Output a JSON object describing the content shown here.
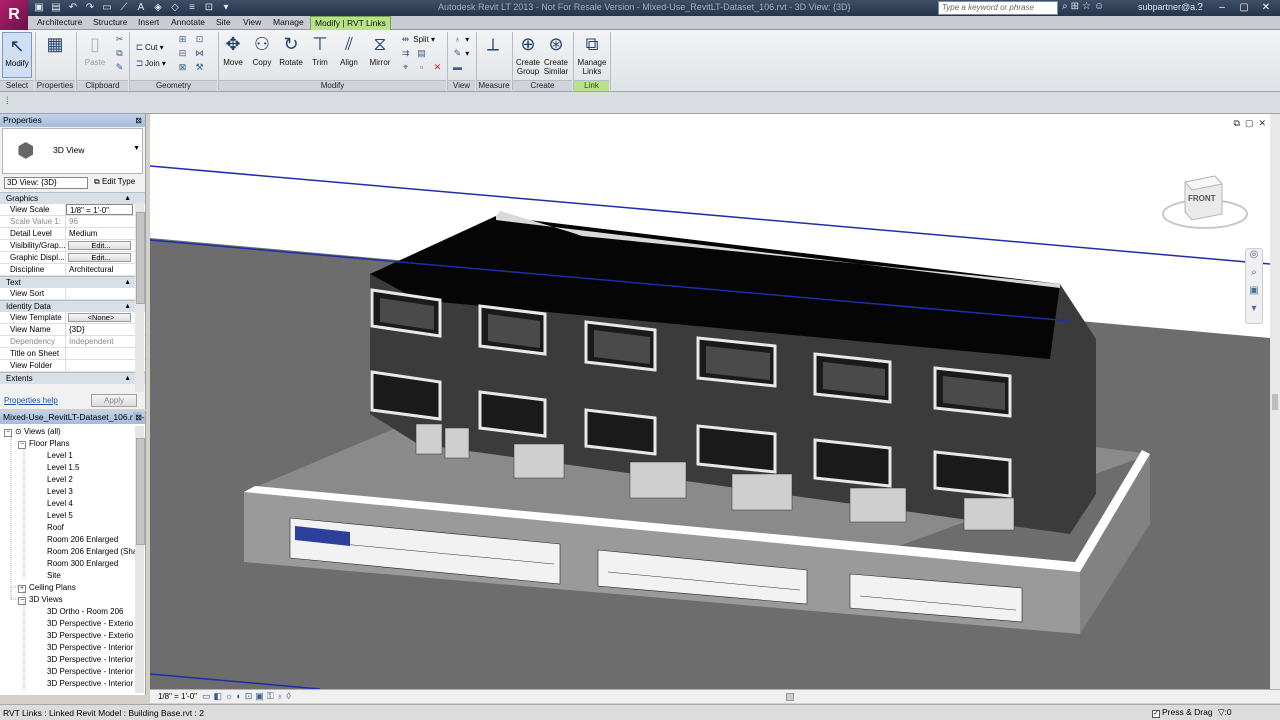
{
  "app": {
    "logo": "R",
    "window_title": "Autodesk Revit LT 2013 - Not For Resale Version -    Mixed-Use_RevitLT-Dataset_106.rvt - 3D View: {3D}"
  },
  "titlebar": {
    "search_placeholder": "Type a keyword or phrase",
    "user": "subpartner@a...",
    "qat_icons": [
      "open-icon",
      "save-icon",
      "undo-icon",
      "redo-icon",
      "print-icon",
      "measure-icon",
      "text-icon",
      "3d-view-icon",
      "section-icon",
      "thin-lines-icon",
      "close-views-icon",
      "switch-windows-icon"
    ]
  },
  "ribbon_tabs": [
    "Architecture",
    "Structure",
    "Insert",
    "Annotate",
    "Site",
    "View",
    "Manage",
    "Modify | RVT Links"
  ],
  "ribbon": {
    "select": {
      "modify": "Modify",
      "label": "Select"
    },
    "properties": {
      "label": "Properties"
    },
    "clipboard": {
      "paste": "Paste",
      "label": "Clipboard"
    },
    "geometry": {
      "cut": "Cut",
      "join": "Join",
      "label": "Geometry"
    },
    "modify": {
      "move": "Move",
      "copy": "Copy",
      "rotate": "Rotate",
      "trim": "Trim",
      "align": "Align",
      "mirror": "Mirror",
      "split": "Split",
      "label": "Modify"
    },
    "view": {
      "label": "View"
    },
    "measure": {
      "label": "Measure"
    },
    "create": {
      "create_group": "Create\nGroup",
      "create_group_1": "Create",
      "create_group_2": "Group",
      "create_similar_1": "Create",
      "create_similar_2": "Similar",
      "label": "Create"
    },
    "link": {
      "manage_1": "Manage",
      "manage_2": "Links",
      "label": "Link"
    }
  },
  "properties": {
    "title": "Properties",
    "type_name": "3D View",
    "view_select": "3D View: {3D}",
    "edit_type": "Edit Type",
    "groups": {
      "graphics": "Graphics",
      "text": "Text",
      "identity": "Identity Data",
      "extents": "Extents"
    },
    "rows": {
      "view_scale": {
        "name": "View Scale",
        "value": "1/8\" = 1'-0\""
      },
      "scale_value": {
        "name": "Scale Value    1:",
        "value": "96"
      },
      "detail_level": {
        "name": "Detail Level",
        "value": "Medium"
      },
      "visibility": {
        "name": "Visibility/Grap...",
        "value": "Edit..."
      },
      "graphic_display": {
        "name": "Graphic Displ...",
        "value": "Edit..."
      },
      "discipline": {
        "name": "Discipline",
        "value": "Architectural"
      },
      "view_sort": {
        "name": "View Sort",
        "value": ""
      },
      "view_template": {
        "name": "View Template",
        "value": "<None>"
      },
      "view_name": {
        "name": "View Name",
        "value": "{3D}"
      },
      "dependency": {
        "name": "Dependency",
        "value": "Independent"
      },
      "title_on_sheet": {
        "name": "Title on Sheet",
        "value": ""
      },
      "view_folder": {
        "name": "View Folder",
        "value": ""
      }
    },
    "help_link": "Properties help",
    "apply": "Apply"
  },
  "browser": {
    "title": "Mixed-Use_RevitLT-Dataset_106.rvt - Project Browser",
    "items": {
      "views_all": "Views (all)",
      "floor_plans": "Floor Plans",
      "level_1": "Level 1",
      "level_1_5": "Level 1.5",
      "level_2": "Level 2",
      "level_3": "Level 3",
      "level_4": "Level 4",
      "level_5": "Level 5",
      "roof": "Roof",
      "room_206": "Room 206 Enlarged",
      "room_206_sh": "Room 206 Enlarged (Sha",
      "room_300": "Room 300 Enlarged",
      "site": "Site",
      "ceiling_plans": "Ceiling Plans",
      "views_3d": "3D Views",
      "ortho_206": "3D Ortho - Room 206",
      "persp_ext_1": "3D Perspective - Exterio",
      "persp_ext_2": "3D Perspective - Exterio",
      "persp_int_1": "3D Perspective - Interior",
      "persp_int_2": "3D Perspective - Interior",
      "persp_int_3": "3D Perspective - Interior",
      "persp_int_4": "3D Perspective - Interior"
    }
  },
  "viewport": {
    "viewcube_face": "FRONT"
  },
  "viewbar": {
    "scale": "1/8\" = 1'-0\""
  },
  "statusbar": {
    "text": "RVT Links : Linked Revit Model : Building Base.rvt : 2",
    "press_drag": "Press & Drag",
    "filter_count": ":0"
  },
  "colors": {
    "accent_tab": "#b8e18b",
    "titlebar": "#26354a",
    "ground": "#6b6b6b",
    "roof": "#000000"
  }
}
